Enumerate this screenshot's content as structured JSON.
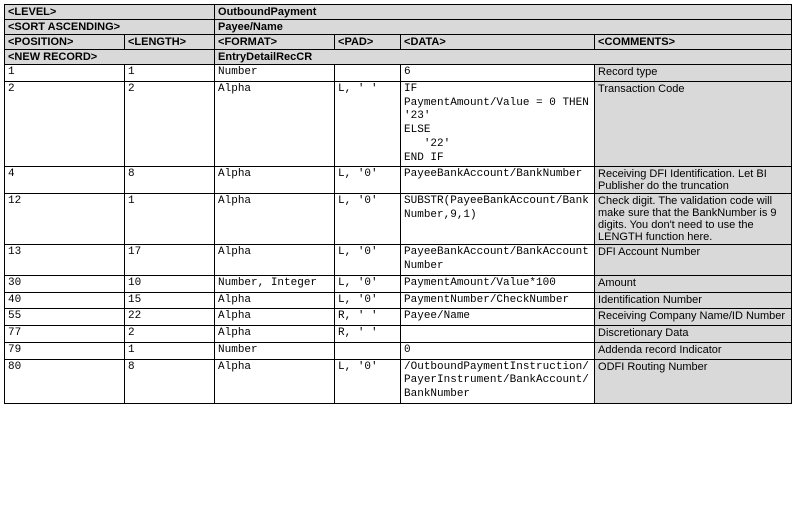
{
  "hdr": {
    "level": "<LEVEL>",
    "level_val": "OutboundPayment",
    "sort": "<SORT ASCENDING>",
    "sort_val": "Payee/Name",
    "position": "<POSITION>",
    "length": "<LENGTH>",
    "format": "<FORMAT>",
    "pad": "<PAD>",
    "data": "<DATA>",
    "comments": "<COMMENTS>",
    "newrec": "<NEW RECORD>",
    "newrec_val": "EntryDetailRecCR"
  },
  "rows": [
    {
      "pos": "1",
      "len": "1",
      "fmt": "Number",
      "pad": "",
      "data": "6",
      "cmt": "Record type"
    },
    {
      "pos": "2",
      "len": "2",
      "fmt": "Alpha",
      "pad": "L, ' '",
      "data": "IF\nPaymentAmount/Value = 0 THEN\n'23'\nELSE\n   '22'\nEND IF",
      "cmt": "Transaction Code"
    },
    {
      "pos": "4",
      "len": "8",
      "fmt": "Alpha",
      "pad": "L, '0'",
      "data": "PayeeBankAccount/BankNumber",
      "cmt": "Receiving DFI Identification. Let BI Publisher do the truncation"
    },
    {
      "pos": "12",
      "len": "1",
      "fmt": "Alpha",
      "pad": "L, '0'",
      "data": "SUBSTR(PayeeBankAccount/BankNumber,9,1)",
      "cmt": "Check digit. The validation code will make sure that the BankNumber is 9 digits. You don't need to use the LENGTH function here."
    },
    {
      "pos": "13",
      "len": "17",
      "fmt": "Alpha",
      "pad": "L, '0'",
      "data": "PayeeBankAccount/BankAccountNumber",
      "cmt": "DFI Account Number"
    },
    {
      "pos": "30",
      "len": "10",
      "fmt": "Number, Integer",
      "pad": "L, '0'",
      "data": "PaymentAmount/Value*100",
      "cmt": "Amount"
    },
    {
      "pos": "40",
      "len": "15",
      "fmt": "Alpha",
      "pad": "L, '0'",
      "data": "PaymentNumber/CheckNumber",
      "cmt": "Identification Number"
    },
    {
      "pos": "55",
      "len": "22",
      "fmt": "Alpha",
      "pad": "R, ' '",
      "data": "Payee/Name",
      "cmt": "Receiving Company Name/ID Number"
    },
    {
      "pos": "77",
      "len": "2",
      "fmt": "Alpha",
      "pad": "R, ' '",
      "data": "",
      "cmt": "Discretionary Data"
    },
    {
      "pos": "79",
      "len": "1",
      "fmt": "Number",
      "pad": "",
      "data": "0",
      "cmt": "Addenda record Indicator"
    },
    {
      "pos": "80",
      "len": "8",
      "fmt": "Alpha",
      "pad": "L, '0'",
      "data": "/OutboundPaymentInstruction/PayerInstrument/BankAccount/BankNumber",
      "cmt": "ODFI Routing Number"
    }
  ]
}
